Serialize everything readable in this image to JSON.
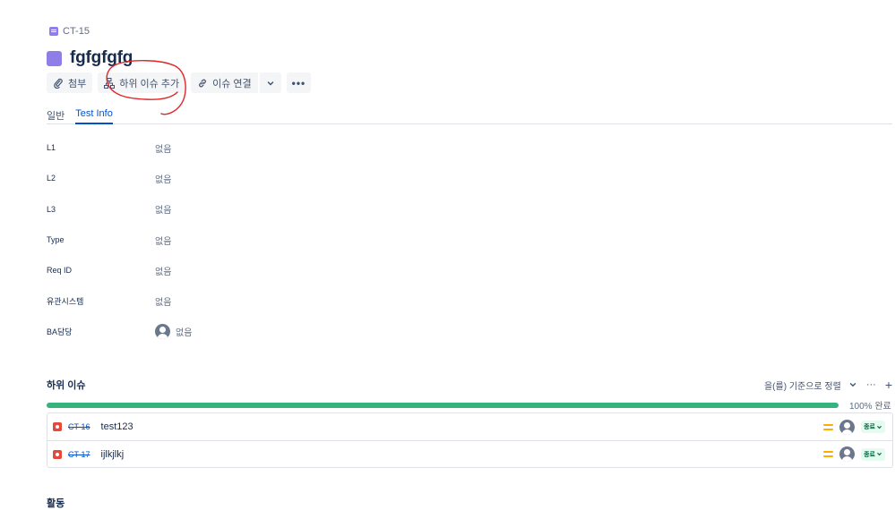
{
  "breadcrumb": {
    "key": "CT-15"
  },
  "issue": {
    "title": "fgfgfgfg"
  },
  "toolbar": {
    "attach_label": "첨부",
    "add_child_label": "하위 이슈 추가",
    "link_label": "이슈 연결",
    "more_label": "•••"
  },
  "tabs": [
    {
      "label": "일반",
      "active": false
    },
    {
      "label": "Test Info",
      "active": true
    }
  ],
  "fields": [
    {
      "label": "L1",
      "value": "없음"
    },
    {
      "label": "L2",
      "value": "없음"
    },
    {
      "label": "L3",
      "value": "없음"
    },
    {
      "label": "Type",
      "value": "없음"
    },
    {
      "label": "Req ID",
      "value": "없음"
    },
    {
      "label": "유관시스템",
      "value": "없음"
    },
    {
      "label": "BA담당",
      "value": "없음"
    }
  ],
  "child_issues": {
    "heading": "하위 이슈",
    "sort_label": "을(를) 기준으로 정렬",
    "more_label": "···",
    "add_label": "+",
    "progress_percent": 100,
    "progress_text": "100% 완료",
    "items": [
      {
        "key": "CT-16",
        "summary": "test123",
        "status": "종료"
      },
      {
        "key": "CT-17",
        "summary": "ijlkjlkj",
        "status": "종료"
      }
    ]
  },
  "activity": {
    "heading": "활동"
  },
  "colors": {
    "accent": "#0052cc",
    "issue_type": "#8f7ee7",
    "progress": "#36b37e",
    "bug": "#e5493a",
    "priority": "#ffab00",
    "annotation": "#e0262a"
  },
  "icons": [
    "paperclip-icon",
    "child-issue-icon",
    "link-icon",
    "chevron-down-icon",
    "more-icon",
    "bug-icon",
    "priority-medium-icon",
    "avatar-icon"
  ]
}
